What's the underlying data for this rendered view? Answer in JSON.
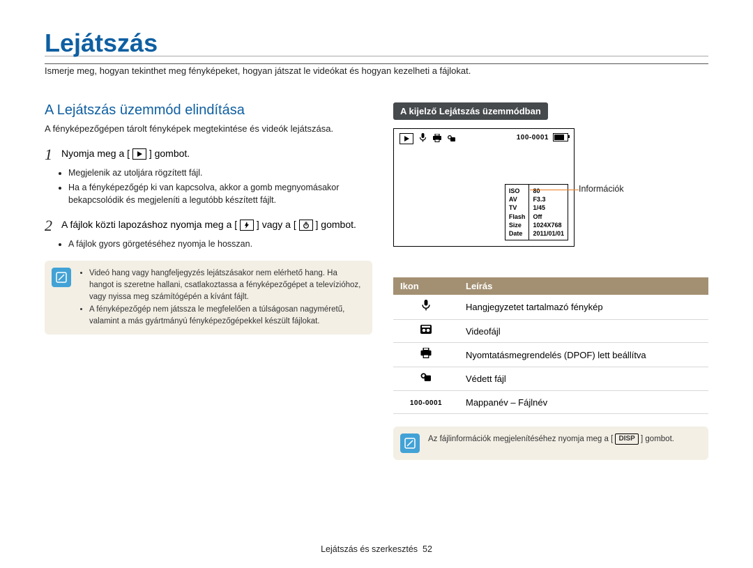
{
  "title": "Lejátszás",
  "intro": "Ismerje meg, hogyan tekinthet meg fényképeket, hogyan játszat le videókat és hogyan kezelheti a fájlokat.",
  "left": {
    "subhead": "A Lejátszás üzemmód elindítása",
    "desc": "A fényképezőgépen tárolt fényképek megtekintése és videók lejátszása.",
    "step1_a": "Nyomja meg a [",
    "step1_b": "] gombot.",
    "step1_bullets": [
      "Megjelenik az utoljára rögzített fájl.",
      "Ha a fényképezőgép ki van kapcsolva, akkor a gomb megnyomásakor bekapcsolódik és megjeleníti a legutóbb készített fájlt."
    ],
    "step2_a": "A fájlok közti lapozáshoz nyomja meg a [",
    "step2_b": "] vagy a [",
    "step2_c": "] gombot.",
    "step2_bullet": "A fájlok gyors görgetéséhez nyomja le hosszan.",
    "note_bullets": [
      "Videó hang vagy hangfeljegyzés lejátszásakor nem elérhető hang. Ha hangot is szeretne hallani, csatlakoztassa a fényképezőgépet a televízióhoz, vagy nyissa meg számítógépén a kívánt fájlt.",
      "A fényképezőgép nem játssza le megfelelően a túlságosan nagyméretű, valamint a más gyártmányú fényképezőgépekkel készült fájlokat."
    ]
  },
  "right": {
    "head": "A kijelző Lejátszás üzemmódban",
    "callout": "Információk",
    "folder_id": "100-0001",
    "info_labels": [
      "ISO",
      "AV",
      "TV",
      "Flash",
      "Size",
      "Date"
    ],
    "info_values": [
      "80",
      "F3.3",
      "1/45",
      "Off",
      "1024X768",
      "2011/01/01"
    ],
    "table_header": {
      "c1": "Ikon",
      "c2": "Leírás"
    },
    "rows": [
      {
        "label": "Hangjegyzetet tartalmazó fénykép"
      },
      {
        "label": "Videofájl"
      },
      {
        "label": "Nyomtatásmegrendelés (DPOF) lett beállítva"
      },
      {
        "label": "Védett fájl"
      },
      {
        "label": "Mappanév – Fájlnév"
      }
    ],
    "note2_a": "Az fájlinformációk megjelenítéséhez nyomja meg a [",
    "note2_b": "] gombot.",
    "disp": "DISP"
  },
  "footer_text": "Lejátszás és szerkesztés",
  "footer_page": "52"
}
